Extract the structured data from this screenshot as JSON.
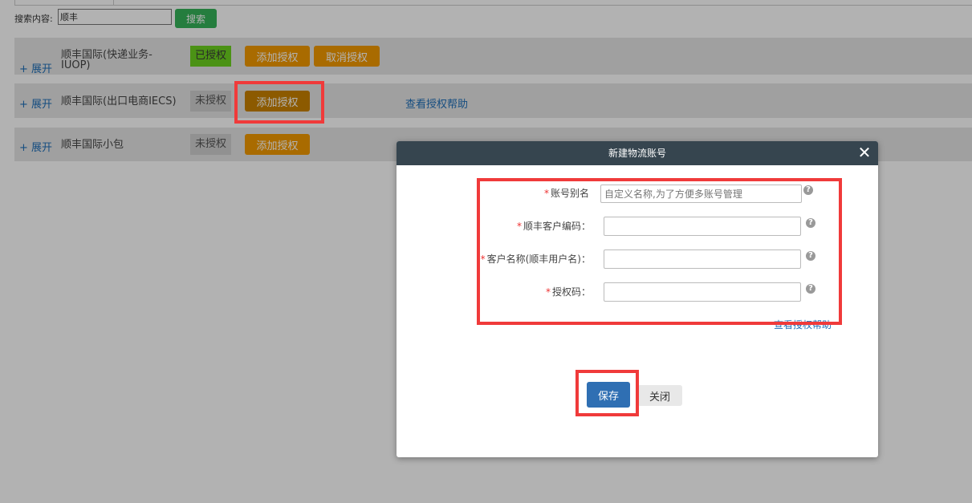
{
  "search": {
    "label": "搜索内容:",
    "value": "顺丰",
    "button": "搜索"
  },
  "rows": [
    {
      "expand": "+ 展开",
      "name": "顺丰国际(快递业务-IUOP)",
      "status": "已授权",
      "add": "添加授权",
      "cancel": "取消授权"
    },
    {
      "expand": "+ 展开",
      "name": "顺丰国际(出口电商IECS)",
      "status": "未授权",
      "add": "添加授权",
      "help": "查看授权帮助"
    },
    {
      "expand": "+ 展开",
      "name": "顺丰国际小包",
      "status": "未授权",
      "add": "添加授权"
    }
  ],
  "modal": {
    "title": "新建物流账号",
    "fields": [
      {
        "label": "账号别名",
        "placeholder": "自定义名称,为了方便多账号管理",
        "value": ""
      },
      {
        "label": "顺丰客户编码：",
        "placeholder": "",
        "value": ""
      },
      {
        "label": "客户名称(顺丰用户名)：",
        "placeholder": "",
        "value": ""
      },
      {
        "label": "授权码：",
        "placeholder": "",
        "value": ""
      }
    ],
    "help_link": "查看授权帮助",
    "save": "保存",
    "close": "关闭"
  },
  "colors": {
    "highlight": "#f03a3a",
    "modal_header": "#36454f",
    "primary": "#2f6fb3",
    "orange": "#f39a00",
    "green": "#36b35a",
    "authorized": "#6cd11f"
  }
}
